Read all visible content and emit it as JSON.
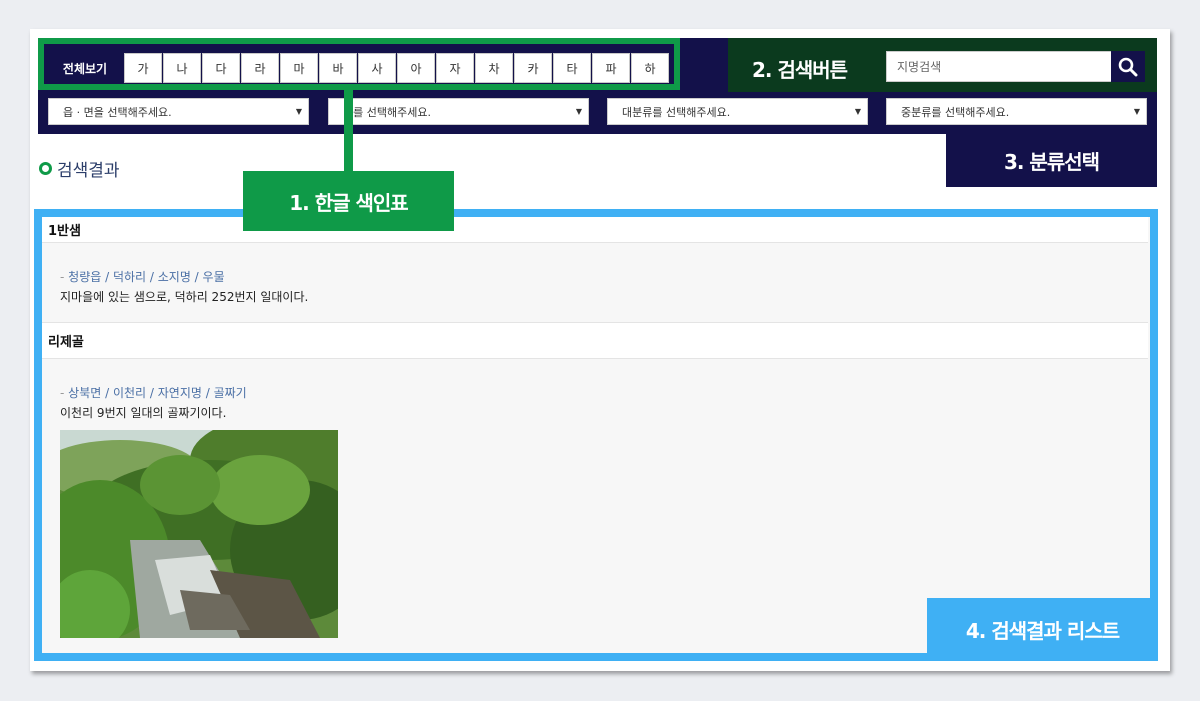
{
  "index": {
    "tabs": [
      "전체보기",
      "가",
      "나",
      "다",
      "라",
      "마",
      "바",
      "사",
      "아",
      "자",
      "차",
      "카",
      "타",
      "파",
      "하"
    ],
    "active": "전체보기"
  },
  "search": {
    "label": "2. 검색버튼",
    "placeholder": "지명검색",
    "icon": "search-icon"
  },
  "filters": [
    "읍 · 면을 선택해주세요.",
    "리를 선택해주세요.",
    "대분류를 선택해주세요.",
    "중분류를 선택해주세요."
  ],
  "annotations": {
    "hangul_index": "1. 한글 색인표",
    "search_button": "2. 검색버튼",
    "category_select": "3. 분류선택",
    "result_list": "4. 검색결과 리스트"
  },
  "results": {
    "title": "검색결과",
    "items": [
      {
        "name": "1반샘",
        "path": "청량읍 / 덕하리 / 소지명 / 우물",
        "desc": "지마을에 있는 샘으로, 덕하리 252번지 일대이다."
      },
      {
        "name": "리제골",
        "path": "상북면 / 이천리 / 자연지명 / 골짜기",
        "desc": "이천리 9번지 일대의 골짜기이다."
      }
    ]
  },
  "colors": {
    "navy": "#13114a",
    "green": "#0f9a48",
    "dark_green": "#0b3a1e",
    "sky_blue": "#3fb0f4"
  }
}
